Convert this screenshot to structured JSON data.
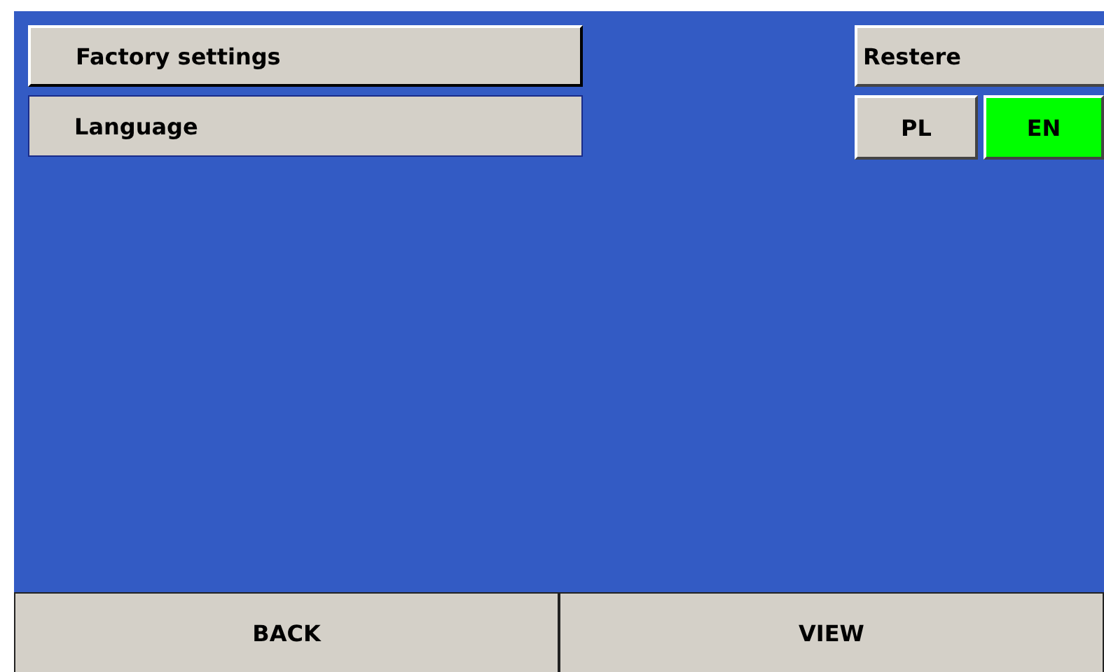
{
  "menu": [
    {
      "label": "Factory settings",
      "selected": false
    },
    {
      "label": "Language",
      "selected": true
    }
  ],
  "restore_button": "Restere",
  "languages": [
    {
      "label": "PL",
      "selected": false
    },
    {
      "label": "EN",
      "selected": true
    }
  ],
  "footer": [
    "BACK",
    "VIEW"
  ]
}
